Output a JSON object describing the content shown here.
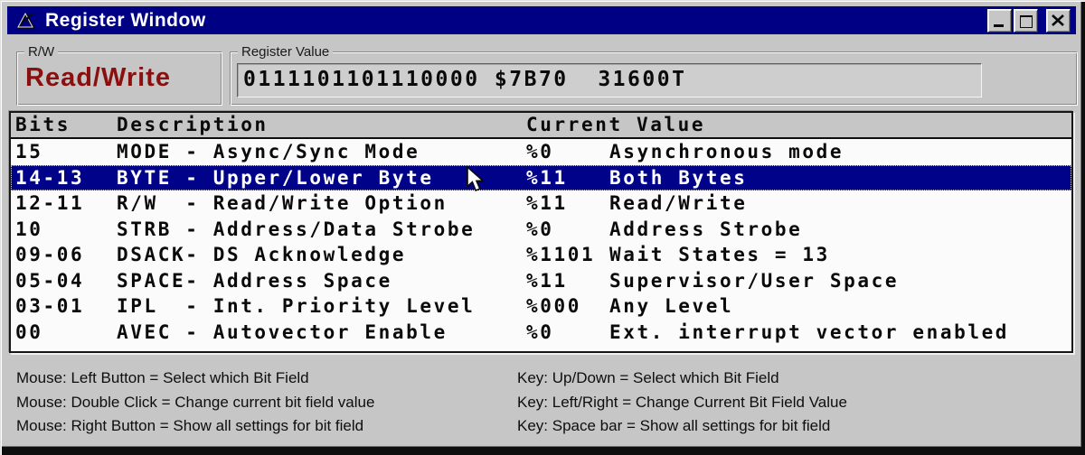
{
  "window": {
    "title": "Register Window",
    "icons": {
      "app": "app-triangle-icon",
      "minimize": "minimize-icon",
      "maximize": "maximize-icon",
      "close": "close-icon",
      "cursor": "arrow-cursor"
    }
  },
  "rw_group": {
    "label": "R/W",
    "value": "Read/Write"
  },
  "register_value_group": {
    "label": "Register Value",
    "value": "0111101101110000 $7B70  31600T"
  },
  "table": {
    "headers": [
      "Bits",
      "Description",
      "Current Value"
    ],
    "selected_index": 1,
    "rows": [
      {
        "bits": "15",
        "description": "MODE - Async/Sync Mode",
        "value": "%0",
        "meaning": "Asynchronous mode"
      },
      {
        "bits": "14-13",
        "description": "BYTE - Upper/Lower Byte",
        "value": "%11",
        "meaning": "Both Bytes"
      },
      {
        "bits": "12-11",
        "description": "R/W  - Read/Write Option",
        "value": "%11",
        "meaning": "Read/Write"
      },
      {
        "bits": "10",
        "description": "STRB - Address/Data Strobe",
        "value": "%0",
        "meaning": "Address Strobe"
      },
      {
        "bits": "09-06",
        "description": "DSACK- DS Acknowledge",
        "value": "%1101",
        "meaning": "Wait States = 13"
      },
      {
        "bits": "05-04",
        "description": "SPACE- Address Space",
        "value": "%11",
        "meaning": "Supervisor/User Space"
      },
      {
        "bits": "03-01",
        "description": "IPL  - Int. Priority Level",
        "value": "%000",
        "meaning": "Any Level"
      },
      {
        "bits": "00",
        "description": "AVEC - Autovector Enable",
        "value": "%0",
        "meaning": "Ext. interrupt vector enabled"
      }
    ]
  },
  "help": {
    "mouse": [
      "Mouse: Left Button = Select which Bit Field",
      "Mouse: Double Click = Change current bit field value",
      "Mouse: Right Button = Show all settings for bit field"
    ],
    "key": [
      "Key: Up/Down = Select which Bit Field",
      "Key: Left/Right = Change Current Bit Field Value",
      "Key: Space bar = Show all settings for bit field"
    ]
  },
  "colors": {
    "titlebar": "#000084",
    "selection": "#000389",
    "accent_red": "#8a1010",
    "chrome": "#c6c6c6"
  }
}
